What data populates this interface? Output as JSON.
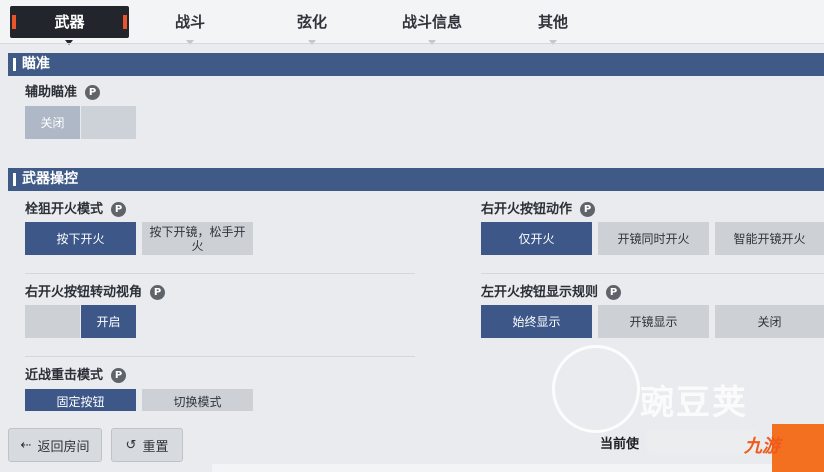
{
  "tabs": [
    {
      "label": "武器",
      "active": true
    },
    {
      "label": "战斗",
      "active": false
    },
    {
      "label": "弦化",
      "active": false
    },
    {
      "label": "战斗信息",
      "active": false
    },
    {
      "label": "其他",
      "active": false
    }
  ],
  "sections": {
    "aim": {
      "title": "瞄准",
      "assist_aim": {
        "label": "辅助瞄准",
        "options": [
          "关闭",
          ""
        ]
      }
    },
    "weapon_control": {
      "title": "武器操控",
      "bolt_fire_mode": {
        "label": "栓狙开火模式",
        "options": [
          "按下开火",
          "按下开镜，松手开火"
        ]
      },
      "right_fire_action": {
        "label": "右开火按钮动作",
        "options": [
          "仅开火",
          "开镜同时开火",
          "智能开镜开火"
        ]
      },
      "right_fire_rotate": {
        "label": "右开火按钮转动视角",
        "options": [
          "",
          "开启"
        ]
      },
      "left_fire_display": {
        "label": "左开火按钮显示规则",
        "options": [
          "始终显示",
          "开镜显示",
          "关闭"
        ]
      },
      "melee_mode": {
        "label": "近战重击模式",
        "options": [
          "固定按钮",
          "切换模式"
        ]
      }
    }
  },
  "help_glyph": "P",
  "footer": {
    "back_label": "返回房间",
    "reset_label": "重置",
    "current_label": "当前使",
    "logo_text": "九游",
    "watermark_text": "豌豆荚"
  },
  "colors": {
    "section_bar": "#3f5a86",
    "selected": "#3c5788",
    "unselected": "#cdd1d6",
    "active_tab": "#22262c",
    "accent": "#e8552a"
  }
}
